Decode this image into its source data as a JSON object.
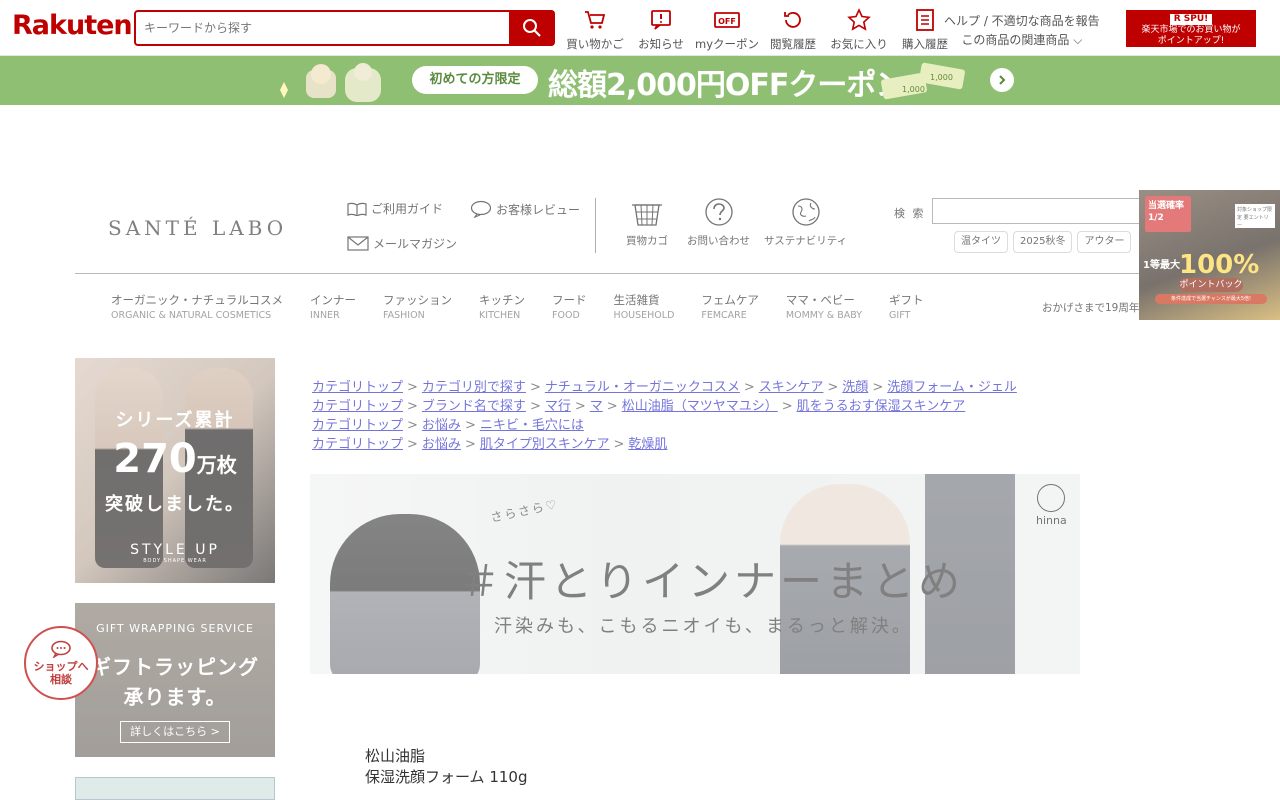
{
  "rakuten": {
    "logo": "Rakuten",
    "search_placeholder": "キーワードから探す",
    "nav": [
      {
        "label": "買い物かご",
        "icon": "cart-icon"
      },
      {
        "label": "お知らせ",
        "icon": "notice-icon"
      },
      {
        "label": "myクーポン",
        "icon": "coupon-icon"
      },
      {
        "label": "閲覧履歴",
        "icon": "history-icon"
      },
      {
        "label": "お気に入り",
        "icon": "star-icon"
      },
      {
        "label": "購入履歴",
        "icon": "receipt-icon"
      }
    ],
    "help": "ヘルプ / 不適切な商品を報告",
    "related": "この商品の関連商品",
    "spu_top": "R SPU!",
    "spu_text": "楽天市場でのお買い物が\nポイントアップ!",
    "accent": "#bf0000"
  },
  "coupon": {
    "pill": "初めての方限定",
    "main": "総額2,000円OFFクーポン",
    "bg": "#8fbf72"
  },
  "shop": {
    "logo": "SANTÉ LABO",
    "links": {
      "guide": "ご利用ガイド",
      "review": "お客様レビュー",
      "mail": "メールマガジン"
    },
    "icons": [
      {
        "label": "買物カゴ",
        "icon": "basket-icon"
      },
      {
        "label": "お問い合わせ",
        "icon": "question-icon"
      },
      {
        "label": "サステナビリティ",
        "icon": "globe-icon"
      }
    ],
    "search_label": "検 索",
    "tags": [
      "温タイツ",
      "2025秋冬",
      "アウター"
    ],
    "categories": [
      {
        "jp": "オーガニック・ナチュラルコスメ",
        "en": "ORGANIC & NATURAL COSMETICS"
      },
      {
        "jp": "インナー",
        "en": "INNER"
      },
      {
        "jp": "ファッション",
        "en": "FASHION"
      },
      {
        "jp": "キッチン",
        "en": "KITCHEN"
      },
      {
        "jp": "フード",
        "en": "FOOD"
      },
      {
        "jp": "生活雑貨",
        "en": "HOUSEHOLD"
      },
      {
        "jp": "フェムケア",
        "en": "FEMCARE"
      },
      {
        "jp": "ママ・ベビー",
        "en": "MOMMY & BABY"
      },
      {
        "jp": "ギフト",
        "en": "GIFT"
      }
    ],
    "anniversary": "おかげさまで19周年"
  },
  "pointback": {
    "badge": "当選確率1/2",
    "small": "対象ショップ限定 要エントリー",
    "l1": "1等最大",
    "pct": "100%",
    "pb": "ポイントバック",
    "note": "条件達成で当選チャンスが最大5倍!"
  },
  "side_banners": {
    "series": {
      "t1": "シリーズ累計",
      "num": "270",
      "unit": "万枚",
      "t3": "突破しました。",
      "brand": "STYLE UP",
      "brand_sub": "BODY SHAPE WEAR"
    },
    "gift": {
      "t0": "GIFT WRAPPING SERVICE",
      "t1": "ギフトラッピング",
      "t2": "承ります。",
      "btn": "詳しくはこちら >"
    }
  },
  "chat": {
    "label": "ショップへ\n相談"
  },
  "breadcrumbs": [
    [
      "カテゴリトップ",
      "カテゴリ別で探す",
      "ナチュラル・オーガニックコスメ",
      "スキンケア",
      "洗顔",
      "洗顔フォーム・ジェル"
    ],
    [
      "カテゴリトップ",
      "ブランド名で探す",
      "マ行",
      "マ",
      "松山油脂（マツヤマユシ）",
      "肌をうるおす保湿スキンケア"
    ],
    [
      "カテゴリトップ",
      "お悩み",
      "ニキビ・毛穴には"
    ],
    [
      "カテゴリトップ",
      "お悩み",
      "肌タイプ別スキンケア",
      "乾燥肌"
    ]
  ],
  "hinna_banner": {
    "sara": "さらさら♡",
    "title": "＃汗とりインナーまとめ",
    "subtitle": "汗染みも、こもるニオイも、まるっと解決。",
    "logo": "hinna"
  },
  "product": {
    "brand": "松山油脂",
    "name": "保湿洗顔フォーム 110g"
  }
}
